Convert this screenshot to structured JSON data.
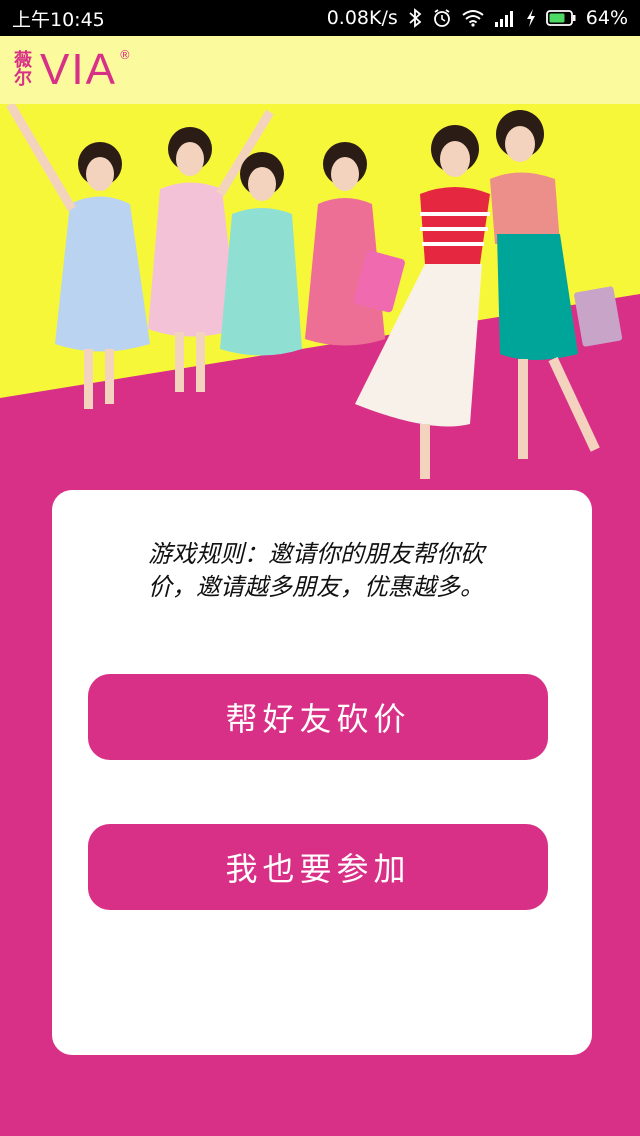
{
  "status_bar": {
    "time": "上午10:45",
    "speed": "0.08K/s",
    "battery_percent": "64%",
    "icons": [
      "bluetooth-icon",
      "alarm-icon",
      "wifi-icon",
      "signal-icon",
      "charging-icon",
      "battery-icon"
    ]
  },
  "header": {
    "logo_cn_top": "薇",
    "logo_cn_bottom": "尔",
    "logo_en": "VIA",
    "logo_mark": "®"
  },
  "card": {
    "rules": "游戏规则：邀请你的朋友帮你砍价，邀请越多朋友，优惠越多。",
    "help_button": "帮好友砍价",
    "join_button": "我也要参加"
  },
  "colors": {
    "brand_pink": "#d93087",
    "header_yellow": "#fbfb9e",
    "hero_yellow": "#f7f73a"
  }
}
